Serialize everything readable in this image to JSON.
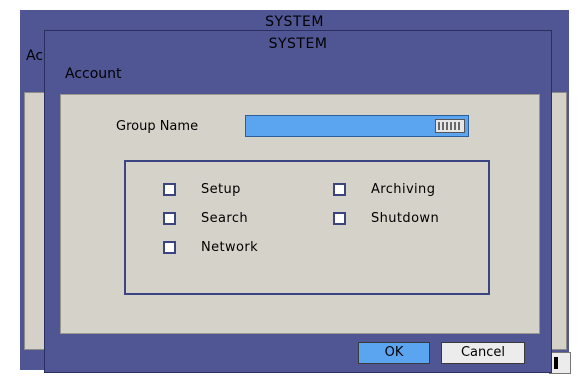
{
  "background_window": {
    "title": "SYSTEM",
    "section": "Ac"
  },
  "window": {
    "title": "SYSTEM",
    "section": "Account"
  },
  "group_name": {
    "label": "Group Name",
    "value": "",
    "keyboard_icon": "keyboard-icon"
  },
  "permissions": [
    {
      "label": "Setup",
      "checked": false
    },
    {
      "label": "Search",
      "checked": false
    },
    {
      "label": "Network",
      "checked": false
    },
    {
      "label": "Archiving",
      "checked": false
    },
    {
      "label": "Shutdown",
      "checked": false
    }
  ],
  "buttons": {
    "ok": "OK",
    "cancel": "Cancel"
  },
  "colors": {
    "window": "#4f5693",
    "panel": "#d5d2ca",
    "input": "#5ba4ef",
    "checkbox_border": "#3b4584"
  }
}
